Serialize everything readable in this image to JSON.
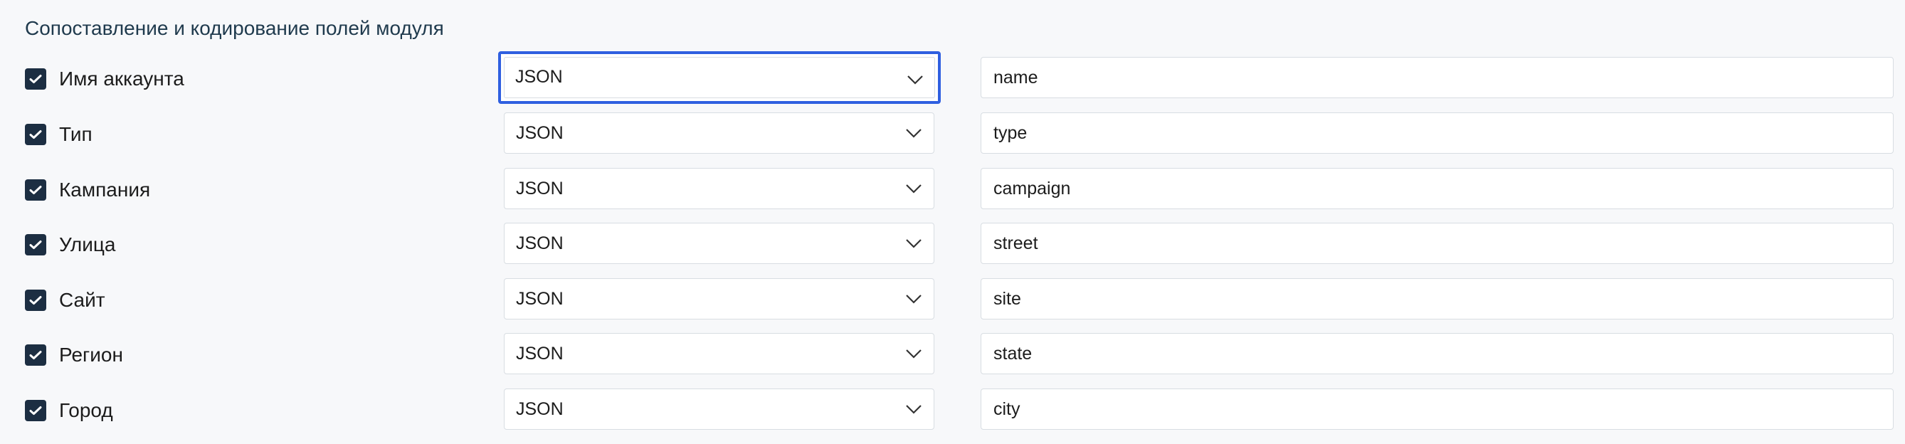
{
  "section": {
    "title": "Сопоставление и кодирование полей модуля"
  },
  "fields": [
    {
      "label": "Имя аккаунта",
      "checked": true,
      "encoding": "JSON",
      "mapping": "name",
      "focused": true
    },
    {
      "label": "Тип",
      "checked": true,
      "encoding": "JSON",
      "mapping": "type"
    },
    {
      "label": "Кампания",
      "checked": true,
      "encoding": "JSON",
      "mapping": "campaign"
    },
    {
      "label": "Улица",
      "checked": true,
      "encoding": "JSON",
      "mapping": "street"
    },
    {
      "label": "Сайт",
      "checked": true,
      "encoding": "JSON",
      "mapping": "site"
    },
    {
      "label": "Регион",
      "checked": true,
      "encoding": "JSON",
      "mapping": "state"
    },
    {
      "label": "Город",
      "checked": true,
      "encoding": "JSON",
      "mapping": "city"
    }
  ],
  "icons": {
    "checkbox": "check-icon",
    "select": "chevron-down-icon"
  },
  "colors": {
    "checkbox_fill": "#1c2e42",
    "focus_ring": "#2f5fe0",
    "title_text": "#1f3a4d"
  }
}
